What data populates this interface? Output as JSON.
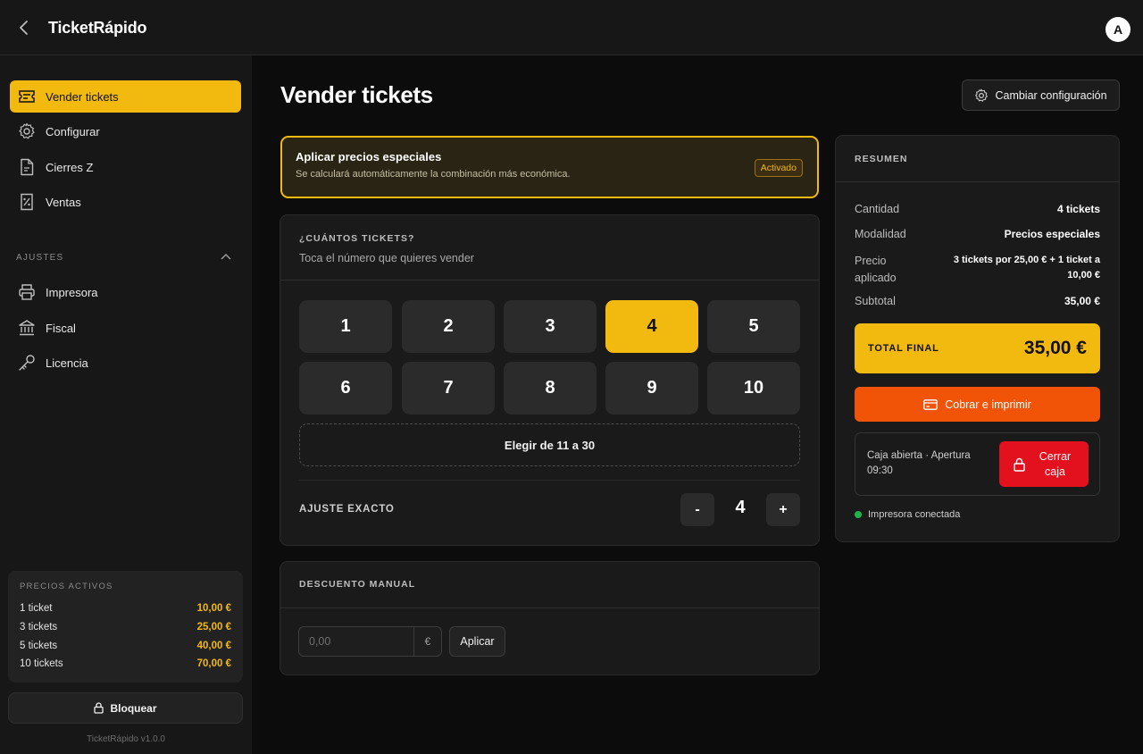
{
  "app": {
    "title": "TicketRápido",
    "avatar_initial": "A",
    "version": "TicketRápido v1.0.0"
  },
  "sidebar": {
    "items": [
      {
        "label": "Vender tickets",
        "icon": "ticket-icon",
        "active": true
      },
      {
        "label": "Configurar",
        "icon": "gear-icon"
      },
      {
        "label": "Cierres Z",
        "icon": "document-icon"
      },
      {
        "label": "Ventas",
        "icon": "receipt-percent-icon"
      }
    ],
    "settings_label": "AJUSTES",
    "settings_items": [
      {
        "label": "Impresora",
        "icon": "printer-icon"
      },
      {
        "label": "Fiscal",
        "icon": "bank-icon"
      },
      {
        "label": "Licencia",
        "icon": "key-icon"
      }
    ],
    "prices": {
      "title": "PRECIOS ACTIVOS",
      "rows": [
        {
          "label": "1 ticket",
          "value": "10,00 €"
        },
        {
          "label": "3 tickets",
          "value": "25,00 €"
        },
        {
          "label": "5 tickets",
          "value": "40,00 €"
        },
        {
          "label": "10 tickets",
          "value": "70,00 €"
        }
      ]
    },
    "lock_label": "Bloquear"
  },
  "main": {
    "title": "Vender tickets",
    "config_button": "Cambiar configuración",
    "special": {
      "title": "Aplicar precios especiales",
      "subtitle": "Se calculará automáticamente la combinación más económica.",
      "badge": "Activado"
    },
    "quantity": {
      "title": "¿CUÁNTOS TICKETS?",
      "subtitle": "Toca el número que quieres vender",
      "numbers": [
        "1",
        "2",
        "3",
        "4",
        "5",
        "6",
        "7",
        "8",
        "9",
        "10"
      ],
      "selected": "4",
      "range_label": "Elegir de 11 a 30",
      "exact_label": "AJUSTE EXACTO",
      "minus": "-",
      "plus": "+",
      "value": "4"
    },
    "discount": {
      "title": "DESCUENTO MANUAL",
      "placeholder": "0,00",
      "currency": "€",
      "apply": "Aplicar"
    }
  },
  "summary": {
    "title": "RESUMEN",
    "rows": {
      "cantidad": {
        "label": "Cantidad",
        "value": "4 tickets"
      },
      "modalidad": {
        "label": "Modalidad",
        "value": "Precios especiales"
      },
      "precio": {
        "label": "Precio aplicado",
        "value": "3 tickets por 25,00 € + 1 ticket a 10,00 €"
      },
      "subtotal": {
        "label": "Subtotal",
        "value": "35,00 €"
      }
    },
    "total_label": "TOTAL FINAL",
    "total_value": "35,00 €",
    "charge_button": "Cobrar e imprimir",
    "cash_status": "Caja abierta · Apertura 09:30",
    "close_button": "Cerrar caja",
    "printer_status": "Impresora conectada"
  },
  "colors": {
    "accent": "#f2b90f",
    "charge": "#f25407",
    "danger": "#e3101e",
    "ok": "#1fb24a"
  }
}
